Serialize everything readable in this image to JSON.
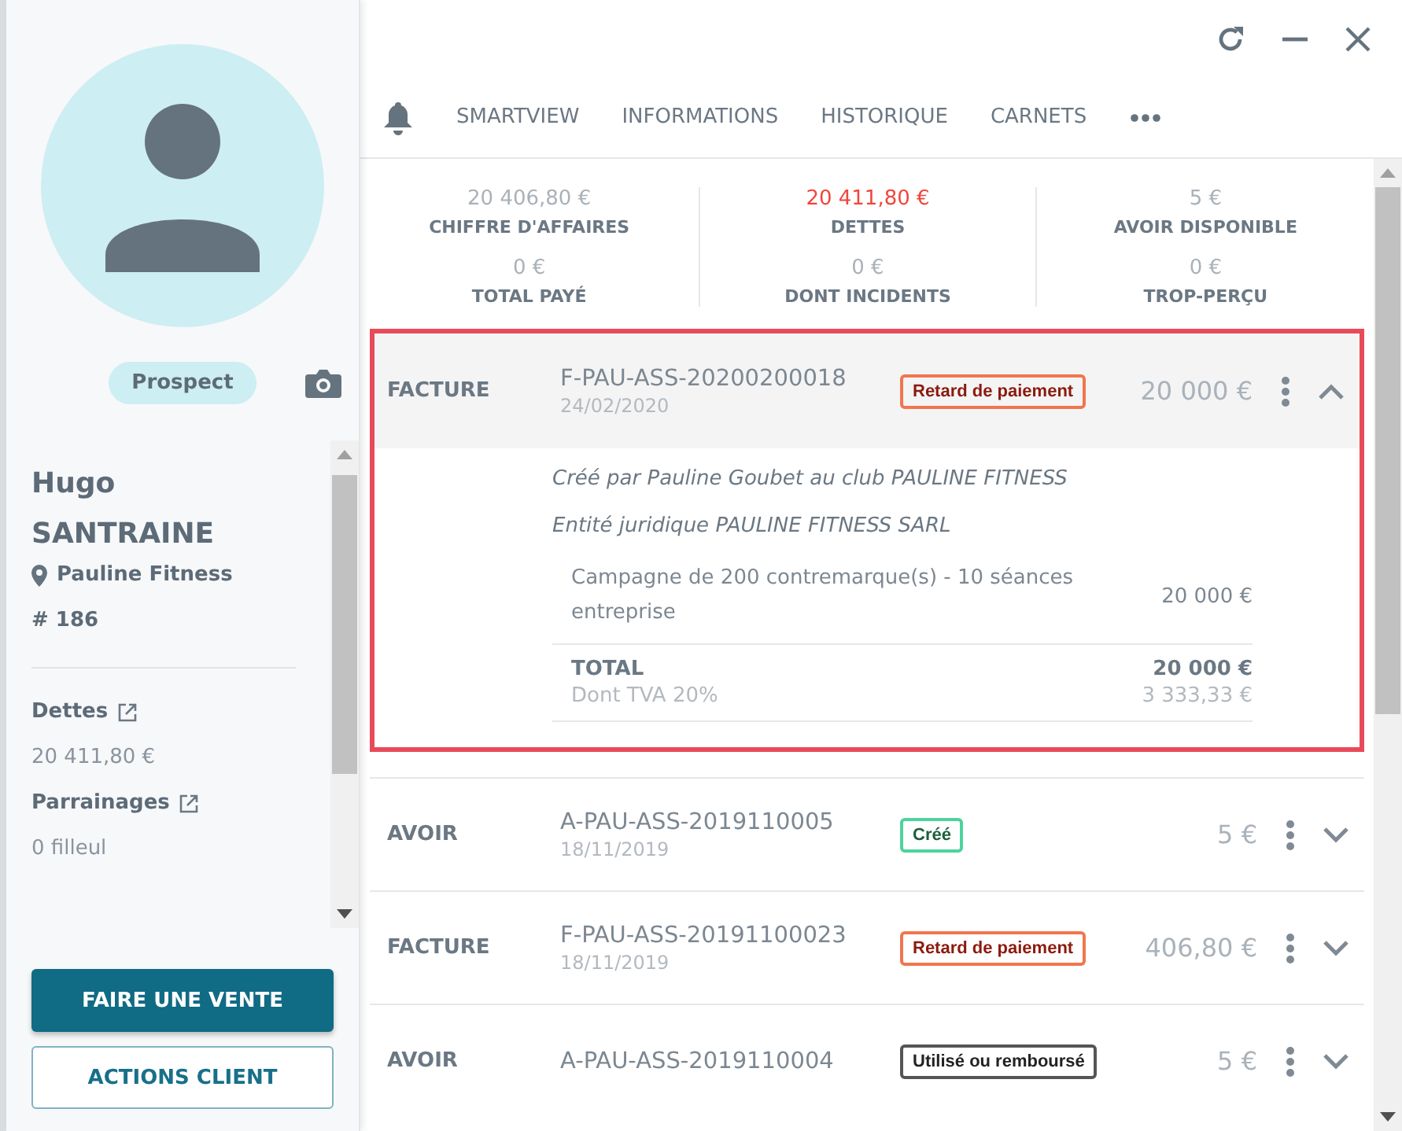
{
  "profile": {
    "status": "Prospect",
    "first_name": "Hugo",
    "last_name": "SANTRAINE",
    "club": "Pauline Fitness",
    "number": "# 186",
    "fields": [
      {
        "label": "Dettes",
        "value": "20 411,80 €"
      },
      {
        "label": "Parrainages",
        "value": "0 filleul"
      }
    ],
    "buttons": [
      {
        "label": "FAIRE UNE VENTE",
        "kind": "primary"
      },
      {
        "label": "ACTIONS CLIENT",
        "kind": "secondary"
      }
    ]
  },
  "tabs": [
    {
      "label": "SMARTVIEW",
      "selected": false
    },
    {
      "label": "INFORMATIONS",
      "selected": false
    },
    {
      "label": "HISTORIQUE",
      "selected": false
    },
    {
      "label": "CARNETS",
      "selected": false
    }
  ],
  "stats": [
    {
      "value": "20 406,80 €",
      "label": "CHIFFRE D'AFFAIRES",
      "alert": false
    },
    {
      "value": "20 411,80 €",
      "label": "DETTES",
      "alert": true
    },
    {
      "value": "5 €",
      "label": "AVOIR DISPONIBLE",
      "alert": false
    },
    {
      "value": "0 €",
      "label": "TOTAL PAYÉ",
      "alert": false
    },
    {
      "value": "0 €",
      "label": "DONT INCIDENTS",
      "alert": false
    },
    {
      "value": "0 €",
      "label": "TROP-PERÇU",
      "alert": false
    }
  ],
  "documents": [
    {
      "type": "FACTURE",
      "number": "F-PAU-ASS-20200200018",
      "date": "24/02/2020",
      "badge": {
        "text": "Retard de paiement",
        "kind": "late"
      },
      "amount": "20 000 €",
      "expanded": true,
      "selected": true,
      "details": {
        "created": "*Créé par* Pauline Goubet *au club* PAULINE FITNESS",
        "entity": "*Entité juridique* PAULINE FITNESS SARL",
        "lines": [
          {
            "label": "Campagne de 200 contremarque(s) - 10 séances entreprise",
            "amount": "20 000 €"
          }
        ],
        "total_label": "TOTAL",
        "total": "20 000 €",
        "vat_label": "Dont TVA 20%",
        "vat": "3 333,33 €"
      }
    },
    {
      "type": "AVOIR",
      "number": "A-PAU-ASS-2019110005",
      "date": "18/11/2019",
      "badge": {
        "text": "Créé",
        "kind": "created"
      },
      "amount": "5 €",
      "expanded": false,
      "selected": false
    },
    {
      "type": "FACTURE",
      "number": "F-PAU-ASS-20191100023",
      "date": "18/11/2019",
      "badge": {
        "text": "Retard de paiement",
        "kind": "late"
      },
      "amount": "406,80 €",
      "expanded": false,
      "selected": false
    },
    {
      "type": "AVOIR",
      "number": "A-PAU-ASS-2019110004",
      "badge": {
        "text": "Utilisé ou remboursé",
        "kind": "used"
      },
      "amount": "5 €",
      "expanded": false,
      "selected": false
    }
  ]
}
